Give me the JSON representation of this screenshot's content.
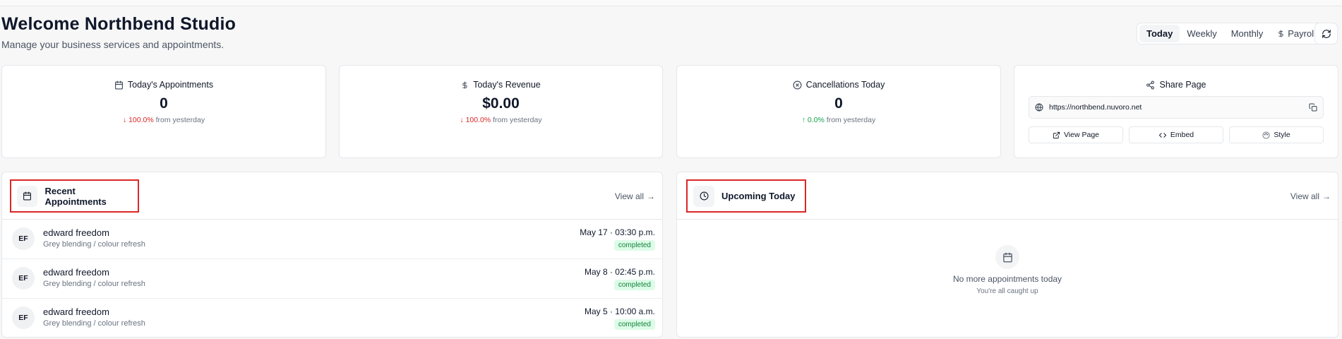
{
  "header": {
    "title": "Welcome Northbend Studio",
    "subtitle": "Manage your business services and appointments."
  },
  "range_tabs": [
    {
      "label": "Today",
      "active": true
    },
    {
      "label": "Weekly",
      "active": false
    },
    {
      "label": "Monthly",
      "active": false
    },
    {
      "label": "Payroll",
      "active": false,
      "icon": "dollar-icon"
    }
  ],
  "stats": [
    {
      "icon": "calendar-icon",
      "label": "Today's Appointments",
      "value": "0",
      "change": "100.0%",
      "direction": "down",
      "suffix": "from yesterday"
    },
    {
      "icon": "dollar-icon",
      "label": "Today's Revenue",
      "value": "$0.00",
      "change": "100.0%",
      "direction": "down",
      "suffix": "from yesterday"
    },
    {
      "icon": "x-circle-icon",
      "label": "Cancellations Today",
      "value": "0",
      "change": "0.0%",
      "direction": "up",
      "suffix": "from yesterday"
    }
  ],
  "share": {
    "title": "Share Page",
    "url": "https://northbend.nuvoro.net",
    "buttons": {
      "view": "View Page",
      "embed": "Embed",
      "style": "Style"
    }
  },
  "recent": {
    "title": "Recent Appointments",
    "view_all": "View all",
    "items": [
      {
        "initials": "EF",
        "name": "edward freedom",
        "service": "Grey blending / colour refresh",
        "time": "May 17 · 03:30 p.m.",
        "status": "completed"
      },
      {
        "initials": "EF",
        "name": "edward freedom",
        "service": "Grey blending / colour refresh",
        "time": "May 8 · 02:45 p.m.",
        "status": "completed"
      },
      {
        "initials": "EF",
        "name": "edward freedom",
        "service": "Grey blending / colour refresh",
        "time": "May 5 · 10:00 a.m.",
        "status": "completed"
      }
    ]
  },
  "upcoming": {
    "title": "Upcoming Today",
    "view_all": "View all",
    "empty_title": "No more appointments today",
    "empty_subtitle": "You're all caught up"
  },
  "colors": {
    "negative": "#dc2626",
    "positive": "#16a34a",
    "badge_bg": "#dcfce7",
    "badge_text": "#15803d",
    "highlight": "#dc2626"
  }
}
